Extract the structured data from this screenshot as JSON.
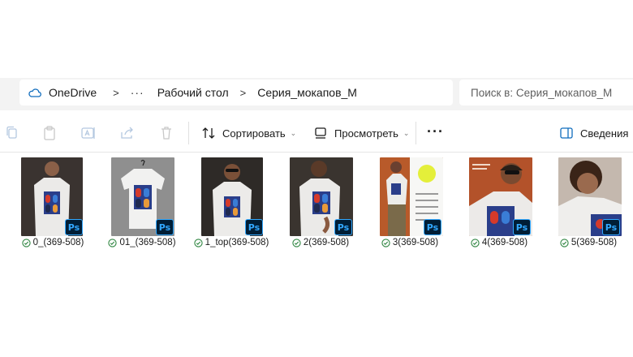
{
  "address_bar": {
    "root": "OneDrive",
    "ellipsis": "···",
    "folder1": "Рабочий стол",
    "folder2": "Серия_мокапов_М",
    "separator": ">",
    "search_placeholder": "Поиск в: Серия_мокапов_М"
  },
  "toolbar": {
    "sort_label": "Сортировать",
    "view_label": "Просмотреть",
    "more_label": "···",
    "details_label": "Сведения",
    "chevron": "⌄"
  },
  "files": [
    {
      "name": "0_(369-508)",
      "type": "psd"
    },
    {
      "name": "01_(369-508)",
      "type": "psd"
    },
    {
      "name": "1_top(369-508)",
      "type": "psd"
    },
    {
      "name": "2(369-508)",
      "type": "psd"
    },
    {
      "name": "3(369-508)",
      "type": "psd"
    },
    {
      "name": "4(369-508)",
      "type": "psd"
    },
    {
      "name": "5(369-508)",
      "type": "psd"
    }
  ],
  "badge_text": "Ps",
  "colors": {
    "accent": "#0f6cbd",
    "sync_ok": "#2e8540",
    "ps_bg": "#001e36",
    "ps_fg": "#31a8ff"
  }
}
